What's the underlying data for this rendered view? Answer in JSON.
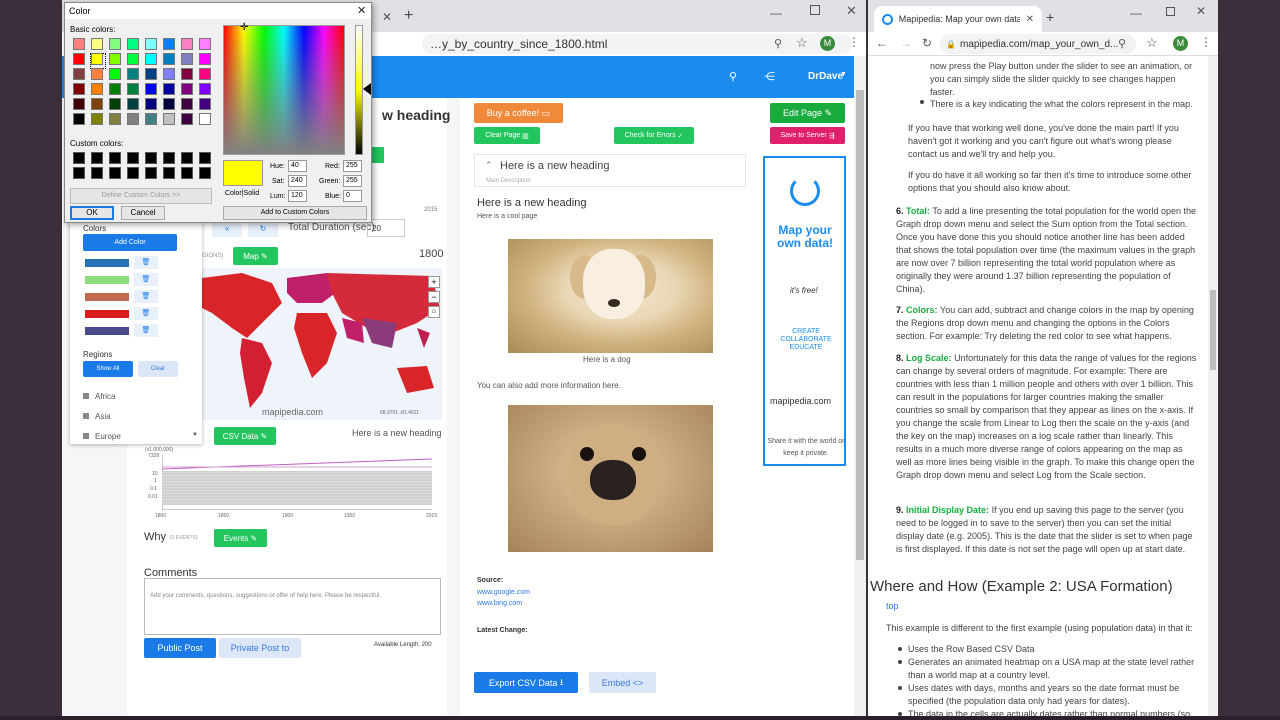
{
  "left_browser": {
    "url": "…y_by_country_since_1800.html",
    "nav": {
      "user": "DrDave"
    },
    "editor": {
      "heading_partial": "w heading",
      "total_duration_label": "Total Duration (sec)",
      "total_duration_value": "20",
      "axis_2015": "2015",
      "colors_title": "Colors",
      "add_color": "Add Color",
      "regions_title": "Regions",
      "show_all": "Show All",
      "clear": "Clear",
      "regions": [
        "Africa",
        "Asia",
        "Europe"
      ],
      "map_button": "Map",
      "regions_tag": "GIONS)",
      "map_year": "1800",
      "map_watermark": "mapipedia.com",
      "map_coords": "68.9701 -81.4911",
      "csv_button": "CSV Data",
      "heading_right": "Here is a new heading",
      "graph_y_top": "(x1,000,000)",
      "graph_y_ticks": [
        "7328",
        "10",
        "1",
        "0.1",
        "0.01"
      ],
      "graph_x_ticks": [
        "1800",
        "1850",
        "1900",
        "1950",
        "2015"
      ],
      "why_title": "Why",
      "why_events": "(0 EVENTS)",
      "events_button": "Events",
      "comments_title": "Comments",
      "comments_placeholder": "Add your comments, questions, suggestions or offer of help here.  Please be respectful.",
      "public_post": "Public Post",
      "private_post": "Private Post to",
      "available_length": "Available Length: 200"
    },
    "content": {
      "buy_coffee": "Buy a coffee!",
      "edit_page": "Edit Page",
      "clear_page": "Clear Page",
      "check_errors": "Check for Errors",
      "save_server": "Save to Server",
      "acc_heading": "Here is a new heading",
      "acc_sub": "Main Description",
      "h2": "Here is a new heading",
      "cool": "Here is a cool page",
      "dog_caption": "Here is a dog",
      "more_info": "You can also add more information here.",
      "source_label": "Source:",
      "sources": [
        "www.google.com",
        "www.bing.com"
      ],
      "latest_change": "Latest Change:",
      "export_csv": "Export CSV Data",
      "embed": "Embed"
    },
    "ad": {
      "headline": "Map your own data!",
      "free": "it's free!",
      "tagline": "CREATE COLLABORATE EDUCATE",
      "site": "mapipedia.com",
      "footer": "Share it with the world or keep it private."
    }
  },
  "color_dialog": {
    "title": "Color",
    "basic_colors": "Basic colors:",
    "custom_colors": "Custom colors:",
    "define_custom": "Define Custom Colors >>",
    "ok": "OK",
    "cancel": "Cancel",
    "color_solid": "Color|Solid",
    "hue_label": "Hue:",
    "hue": "40",
    "sat_label": "Sat:",
    "sat": "240",
    "lum_label": "Lum:",
    "lum": "120",
    "red_label": "Red:",
    "red": "255",
    "green_label": "Green:",
    "green": "255",
    "blue_label": "Blue:",
    "blue": "0",
    "add_custom": "Add to Custom Colors",
    "basic_palette": [
      "#ff8080",
      "#ffff80",
      "#80ff80",
      "#00ff80",
      "#80ffff",
      "#0080ff",
      "#ff80c0",
      "#ff80ff",
      "#ff0000",
      "#ffff00",
      "#80ff00",
      "#00ff40",
      "#00ffff",
      "#0080c0",
      "#8080c0",
      "#ff00ff",
      "#804040",
      "#ff8040",
      "#00ff00",
      "#008080",
      "#004080",
      "#8080ff",
      "#800040",
      "#ff0080",
      "#800000",
      "#ff8000",
      "#008000",
      "#008040",
      "#0000ff",
      "#0000a0",
      "#800080",
      "#8000ff",
      "#400000",
      "#804000",
      "#004000",
      "#004040",
      "#000080",
      "#000040",
      "#400040",
      "#400080",
      "#000000",
      "#808000",
      "#808040",
      "#808080",
      "#408080",
      "#c0c0c0",
      "#400040",
      "#ffffff"
    ]
  },
  "right_browser": {
    "tab_title": "Mapipedia: Map your own data!",
    "url": "mapipedia.com/map_your_own_d...",
    "bullets_top": [
      "now press the Play button under the slider to see an animation, or you can simply slide the slider quickly to see changes happen faster.",
      "There is a key indicating the what the colors represent in the map."
    ],
    "p1": "If you have that working well done, you've done the main part! If you haven't got it working and you can't figure out what's wrong please contact us and we'll try and help you.",
    "p2": "If you do have it all working so far then it's time to introduce some other options that you should also know about.",
    "items": [
      {
        "n": "6.",
        "title": "Total:",
        "text": "To add a line presenting the total population for the world open the Graph drop down menu and select the Sum option from the Total section. Once you have done this you should notice another line has been added that shows the total population over time (the maximum values in the graph are now over 7 billion representing the total world population where as originally they were around 1.37 billion representing the population of China)."
      },
      {
        "n": "7.",
        "title": "Colors:",
        "text": "You can add, subtract and change colors in the map by opening the Regions drop down menu and changing the options in the Colors section. For example: Try deleting the red color to see what happens."
      },
      {
        "n": "8.",
        "title": "Log Scale:",
        "text": "Unfortunately for this data the range of values for the regions can change by several orders of magnitude. For example: There are countries with less than 1 million people and others with over 1 billion. This can result in the populations for larger countries making the smaller countries so small by comparison that they appear as lines on the x-axis. If you change the scale from Linear to Log then the scale on the y-axis (and the key on the map) increases on a log scale rather than linearly. This results in a much more diverse range of colors appearing on the map as well as more lines being visible in the graph. To make this change open the Graph drop down menu and select Log from the Scale section."
      },
      {
        "n": "9.",
        "title": "Initial Display Date:",
        "text": "If you end up saving this page to the server (you need to be logged in to save to the server) then you can set the initial display date (e.g. 2005). This is the date that the slider is set to when page is first displayed. If this date is not set the page will open up at start date."
      }
    ],
    "section_heading": "Where and How (Example 2: USA Formation)",
    "top_link": "top",
    "intro": "This example is different to the first example (using population data) in that it:",
    "bullets_bottom": [
      "Uses the Row Based CSV Data",
      "Generates an animated heatmap on a USA map at the state level rather than a world map at a country level.",
      "Uses dates with days, months and years so the date format must be specified (the population data only had years for dates).",
      "The data in the cells are actually dates rather than normal numbers (so"
    ]
  }
}
